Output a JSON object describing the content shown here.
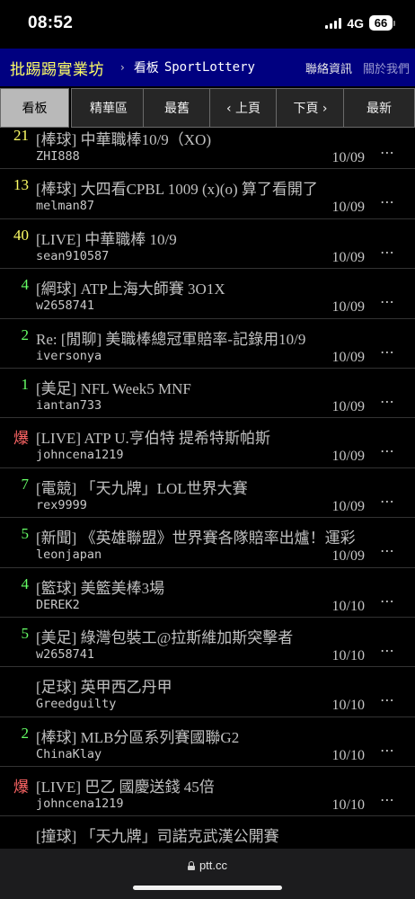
{
  "status_bar": {
    "time": "08:52",
    "network": "4G",
    "battery": "66",
    "signal_icon": "signal-bars-icon",
    "battery_icon": "battery-icon"
  },
  "top_bar": {
    "site_title": "批踢踢實業坊",
    "separator": "›",
    "board_label": "看板",
    "board_name": "SportLottery",
    "contact": "聯絡資訊",
    "about": "關於我們"
  },
  "actions": {
    "board": "看板",
    "digest": "精華區",
    "oldest": "最舊",
    "prev": "‹ 上頁",
    "next": "下頁 ›",
    "newest": "最新"
  },
  "colors": {
    "top_bar_bg": "#000080",
    "site_title": "#ffff66",
    "rec_yellow": "#ffff66",
    "rec_green": "#66ff66",
    "rec_hot": "#ff6666"
  },
  "entries": [
    {
      "rec": "21",
      "title": "[棒球] 中華職棒10/9（XO)",
      "author": "ZHI888",
      "date": "10/09",
      "more": "⋯"
    },
    {
      "rec": "13",
      "title": "[棒球] 大四看CPBL 1009 (x)(o) 算了看開了",
      "author": "melman87",
      "date": "10/09",
      "more": "⋯"
    },
    {
      "rec": "40",
      "title": "[LIVE] 中華職棒 10/9",
      "author": "sean910587",
      "date": "10/09",
      "more": "⋯"
    },
    {
      "rec": "4",
      "title": "[網球] ATP上海大師賽 3O1X",
      "author": "w2658741",
      "date": "10/09",
      "more": "⋯"
    },
    {
      "rec": "2",
      "title": "Re: [閒聊] 美職棒總冠軍賠率-記錄用10/9",
      "author": "iversonya",
      "date": "10/09",
      "more": "⋯"
    },
    {
      "rec": "1",
      "title": "[美足] NFL Week5 MNF",
      "author": "iantan733",
      "date": "10/09",
      "more": "⋯"
    },
    {
      "rec": "爆",
      "title": "[LIVE] ATP U.亨伯特 提希特斯帕斯",
      "author": "johncena1219",
      "date": "10/09",
      "more": "⋯"
    },
    {
      "rec": "7",
      "title": "[電競] 「天九牌」LOL世界大賽",
      "author": "rex9999",
      "date": "10/09",
      "more": "⋯"
    },
    {
      "rec": "5",
      "title": "[新聞] 《英雄聯盟》世界賽各隊賠率出爐！運彩",
      "author": "leonjapan",
      "date": "10/09",
      "more": "⋯"
    },
    {
      "rec": "4",
      "title": "[籃球] 美籃美棒3場",
      "author": "DEREK2",
      "date": "10/10",
      "more": "⋯"
    },
    {
      "rec": "5",
      "title": "[美足] 綠灣包裝工@拉斯維加斯突擊者",
      "author": "w2658741",
      "date": "10/10",
      "more": "⋯"
    },
    {
      "rec": "",
      "title": "[足球] 英甲西乙丹甲",
      "author": "Greedguilty",
      "date": "10/10",
      "more": "⋯"
    },
    {
      "rec": "2",
      "title": "[棒球] MLB分區系列賽國聯G2",
      "author": "ChinaKlay",
      "date": "10/10",
      "more": "⋯"
    },
    {
      "rec": "爆",
      "title": "[LIVE] 巴乙 國慶送錢 45倍",
      "author": "johncena1219",
      "date": "10/10",
      "more": "⋯"
    },
    {
      "rec": "",
      "title": "[撞球] 「天九牌」司諾克武漢公開賽",
      "author": "",
      "date": "",
      "more": ""
    }
  ],
  "browser": {
    "url": "ptt.cc",
    "lock_icon": "lock-icon"
  }
}
